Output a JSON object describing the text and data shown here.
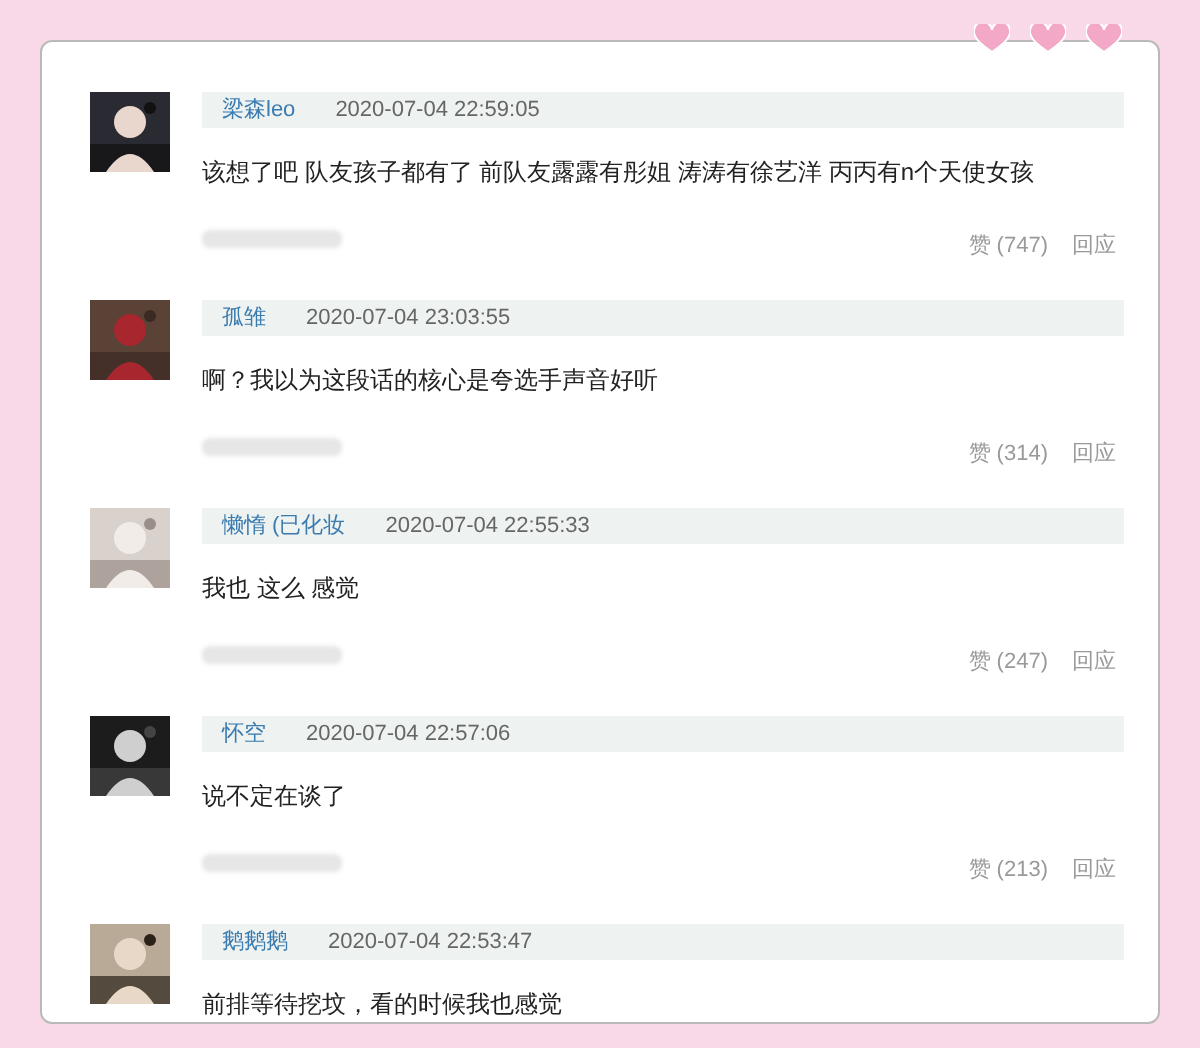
{
  "comments": [
    {
      "user": "梁森leo",
      "time": "2020-07-04 22:59:05",
      "text": "该想了吧 队友孩子都有了 前队友露露有彤姐 涛涛有徐艺洋 丙丙有n个天使女孩",
      "likes": "赞 (747)",
      "reply": "回应"
    },
    {
      "user": "孤雏",
      "time": "2020-07-04 23:03:55",
      "text": "啊？我以为这段话的核心是夸选手声音好听",
      "likes": "赞 (314)",
      "reply": "回应"
    },
    {
      "user": "懒惰 (已化妆",
      "time": "2020-07-04 22:55:33",
      "text": "我也 这么 感觉",
      "likes": "赞 (247)",
      "reply": "回应"
    },
    {
      "user": "怀空",
      "time": "2020-07-04 22:57:06",
      "text": "说不定在谈了",
      "likes": "赞 (213)",
      "reply": "回应"
    },
    {
      "user": "鹅鹅鹅",
      "time": "2020-07-04 22:53:47",
      "text": "前排等待挖坟，看的时候我也感觉"
    }
  ]
}
